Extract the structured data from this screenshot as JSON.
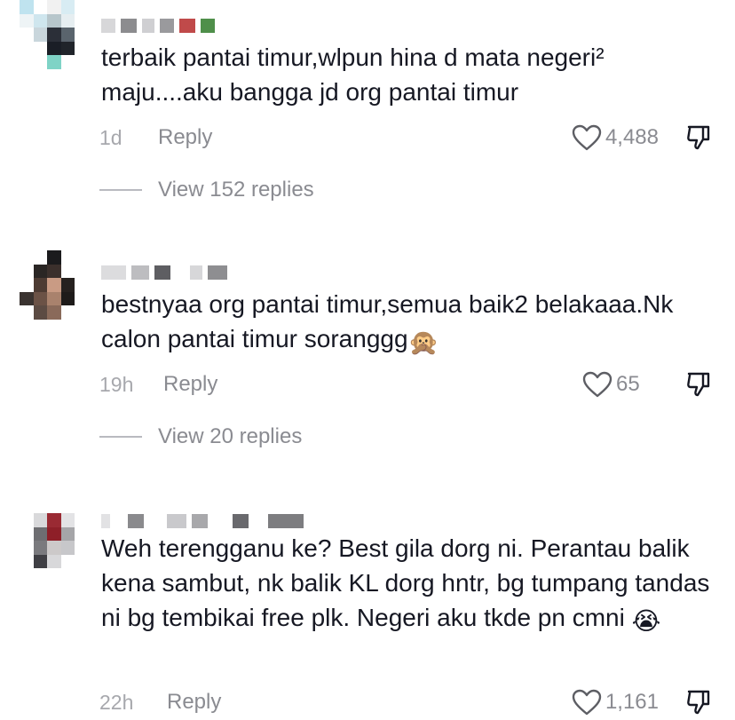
{
  "comments": [
    {
      "text": "terbaik pantai timur,wlpun hina d mata negeri² maju....aku bangga jd org pantai timur",
      "time": "1d",
      "reply_label": "Reply",
      "likes": "4,488",
      "view_replies": "View 152 replies"
    },
    {
      "text": "bestnyaa org pantai timur,semua baik2 belakaaa.Nk calon pantai timur soranggg",
      "emoji": "🙊",
      "time": "19h",
      "reply_label": "Reply",
      "likes": "65",
      "view_replies": "View 20 replies"
    },
    {
      "text": "Weh terengganu ke? Best gila dorg ni. Perantau balik kena sambut, nk balik KL dorg hntr, bg tumpang tandas ni bg tembikai free plk. Negeri aku tkde pn cmni",
      "emoji": "😭",
      "time": "22h",
      "reply_label": "Reply",
      "likes": "1,161"
    }
  ],
  "icons": {
    "like": "heart-outline-icon",
    "dislike": "thumbs-down-outline-icon"
  },
  "colors": {
    "text": "#161823",
    "muted": "#8a8b91",
    "timestamp": "#a7a8ad"
  }
}
